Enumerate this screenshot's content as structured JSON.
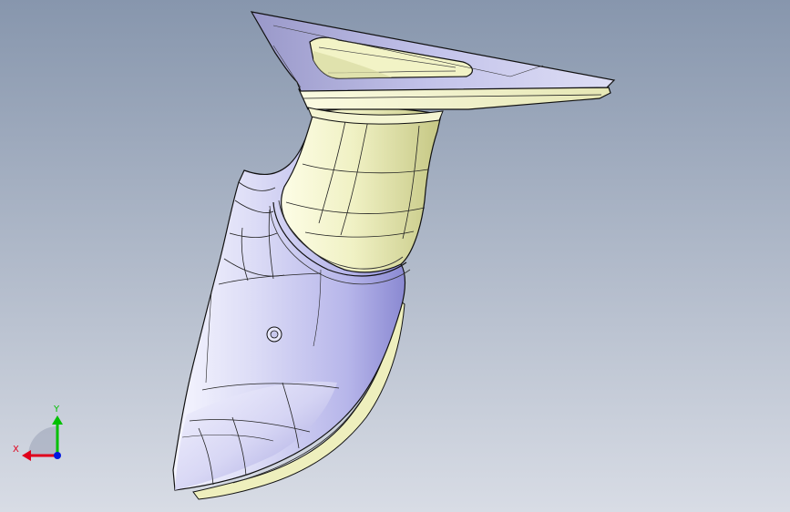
{
  "viewport": {
    "background_top": "#8796ad",
    "background_bottom": "#d8dce5"
  },
  "colors": {
    "surface_blue": "#dcdcf6",
    "surface_blue_shadow": "#8a89d2",
    "surface_yellow": "#f0f1c4",
    "surface_yellow_shadow": "#b9bb74",
    "edge": "#111111"
  },
  "model": {
    "icon": "cad-part-model"
  },
  "triad": {
    "x_label": "X",
    "y_label": "Y",
    "x_color": "#e0001b",
    "y_color": "#00c000",
    "z_color": "#0018e0"
  }
}
